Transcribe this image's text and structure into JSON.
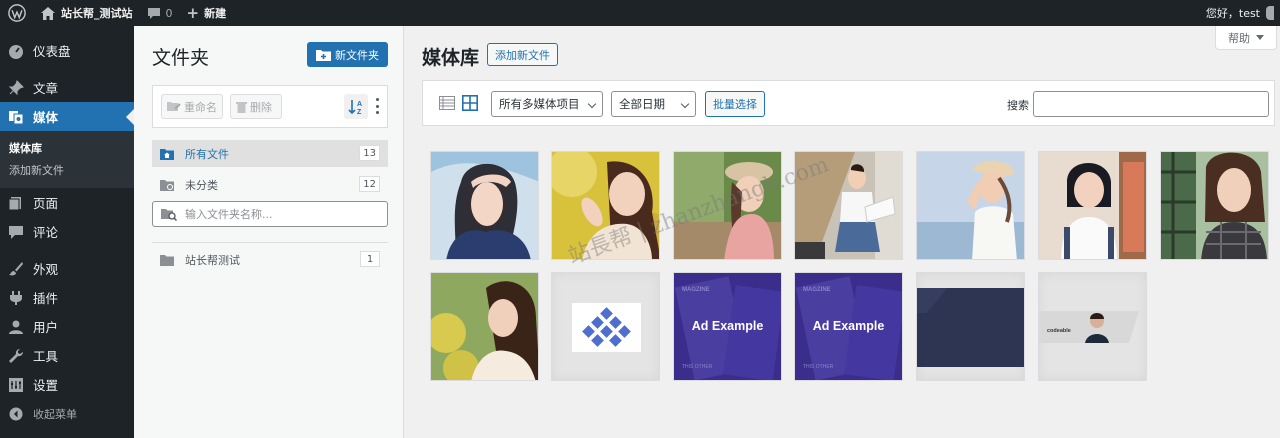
{
  "adminbar": {
    "site_name": "站长帮_测试站",
    "comments_count": "0",
    "new_label": "新建",
    "greeting": "您好，test"
  },
  "sidebar": {
    "items": [
      {
        "label": "仪表盘",
        "icon": "dashboard-icon"
      },
      {
        "label": "文章",
        "icon": "pin-icon"
      },
      {
        "label": "媒体",
        "icon": "media-icon"
      },
      {
        "label": "页面",
        "icon": "page-icon"
      },
      {
        "label": "评论",
        "icon": "comment-icon"
      },
      {
        "label": "外观",
        "icon": "brush-icon"
      },
      {
        "label": "插件",
        "icon": "plugin-icon"
      },
      {
        "label": "用户",
        "icon": "user-icon"
      },
      {
        "label": "工具",
        "icon": "wrench-icon"
      },
      {
        "label": "设置",
        "icon": "settings-icon"
      }
    ],
    "submenu": [
      "媒体库",
      "添加新文件"
    ],
    "collapse_label": "收起菜单"
  },
  "folders": {
    "title": "文件夹",
    "new_folder_label": "新文件夹",
    "rename_label": "重命名",
    "delete_label": "删除",
    "all_files_label": "所有文件",
    "all_files_count": "13",
    "uncategorized_label": "未分类",
    "uncategorized_count": "12",
    "search_placeholder": "输入文件夹名称...",
    "list": [
      {
        "name": "站长帮测试",
        "count": "1"
      }
    ]
  },
  "main": {
    "title": "媒体库",
    "add_new_label": "添加新文件",
    "help_label": "帮助",
    "filter_type": "所有多媒体项目",
    "filter_date": "全部日期",
    "bulk_select_label": "批量选择",
    "search_label": "搜索",
    "thumb_texts": [
      "Ad Example",
      "Ad Example",
      "codeable"
    ]
  },
  "colors": {
    "admin_dark": "#1d2327",
    "accent": "#2271b1",
    "thumb_purple": "#3a2d8c",
    "thumb_navy": "#2d3552"
  },
  "watermark": "站長帮 | zhanzhangb.com"
}
